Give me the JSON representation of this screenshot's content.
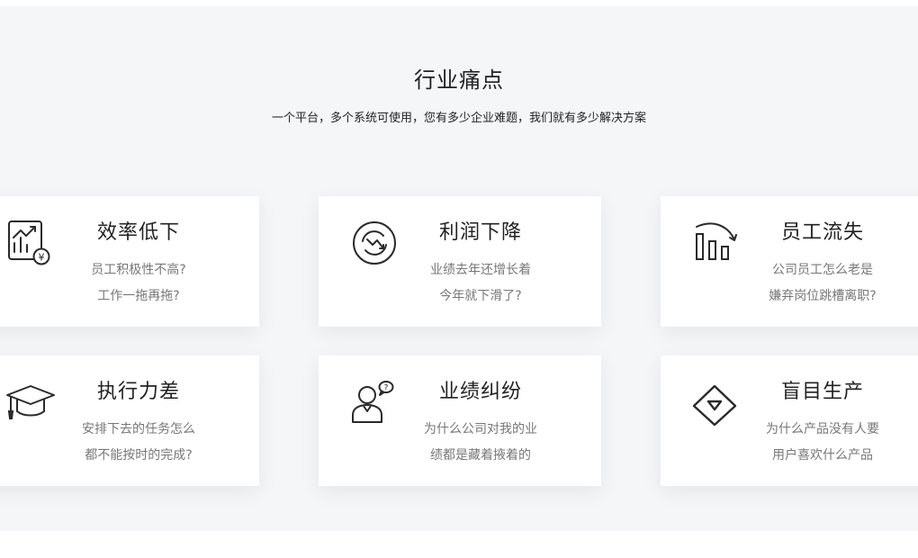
{
  "header": {
    "title": "行业痛点",
    "subtitle": "一个平台，多个系统可使用，您有多少企业难题，我们就有多少解决方案"
  },
  "cards": [
    {
      "icon": "chart-yuan-icon",
      "title": "效率低下",
      "line1": "员工积极性不高?",
      "line2": "工作一拖再拖?"
    },
    {
      "icon": "declining-trend-icon",
      "title": "利润下降",
      "line1": "业绩去年还增长着",
      "line2": "今年就下滑了?"
    },
    {
      "icon": "bar-chart-decline-icon",
      "title": "员工流失",
      "line1": "公司员工怎么老是",
      "line2": "嫌弃岗位跳槽离职?"
    },
    {
      "icon": "graduation-cap-icon",
      "title": "执行力差",
      "line1": "安排下去的任务怎么",
      "line2": "都不能按时的完成?"
    },
    {
      "icon": "person-question-icon",
      "title": "业绩纠纷",
      "line1": "为什么公司对我的业",
      "line2": "绩都是藏着掖着的"
    },
    {
      "icon": "diamond-icon",
      "title": "盲目生产",
      "line1": "为什么产品没有人要",
      "line2": "用户喜欢什么产品"
    }
  ],
  "colors": {
    "section_bg": "#f5f6f8",
    "card_bg": "#ffffff",
    "title": "#222222",
    "body_text": "#777777",
    "icon": "#2a2a2a"
  }
}
